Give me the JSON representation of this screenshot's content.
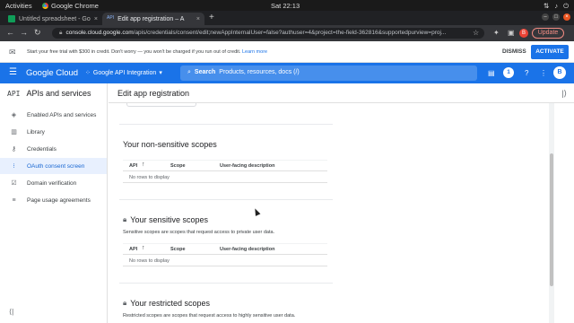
{
  "os": {
    "activities": "Activities",
    "app_name": "Google Chrome",
    "clock": "Sat 22:13"
  },
  "tabs": [
    {
      "title": "Untitled spreadsheet - Go",
      "close": "×"
    },
    {
      "title": "Edit app registration – A",
      "favicon": "API",
      "close": "×"
    }
  ],
  "browser": {
    "new_tab": "+",
    "url_host": "console.cloud.google.com",
    "url_path": "/apis/credentials/consent/edit;newAppInternalUser=false?authuser=4&project=the-field-362816&supportedpurview=proj...",
    "update_label": "Update",
    "profile_initial": "B"
  },
  "banner": {
    "message": "Start your free trial with $300 in credit. Don't worry — you won't be charged if you run out of credit.",
    "link": "Learn more",
    "dismiss": "DISMISS",
    "activate": "ACTIVATE"
  },
  "header": {
    "brand": "Google Cloud",
    "project": "Google API Integration",
    "search_label": "Search",
    "search_placeholder": "Products, resources, docs (/)",
    "notification_count": "1",
    "user_initial": "B"
  },
  "sidebar": {
    "title": "APIs and services",
    "api_glyph": "API",
    "items": [
      {
        "label": "Enabled APIs and services",
        "icon": "diamond-icon"
      },
      {
        "label": "Library",
        "icon": "library-icon"
      },
      {
        "label": "Credentials",
        "icon": "key-icon"
      },
      {
        "label": "OAuth consent screen",
        "icon": "consent-icon"
      },
      {
        "label": "Domain verification",
        "icon": "checkbox-icon"
      },
      {
        "label": "Page usage agreements",
        "icon": "settings-list-icon"
      }
    ]
  },
  "main": {
    "page_title": "Edit app registration",
    "sections": [
      {
        "title": "Your non-sensitive scopes",
        "description": "",
        "columns": [
          "API",
          "Scope",
          "User-facing description"
        ],
        "empty": "No rows to display"
      },
      {
        "title": "Your sensitive scopes",
        "description": "Sensitive scopes are scopes that request access to private user data.",
        "columns": [
          "API",
          "Scope",
          "User-facing description"
        ],
        "empty": "No rows to display"
      },
      {
        "title": "Your restricted scopes",
        "description": "Restricted scopes are scopes that request access to highly sensitive user data.",
        "columns": [],
        "empty": ""
      }
    ]
  },
  "colors": {
    "accent": "#1a73e8",
    "active_nav_bg": "#e8f0fe"
  }
}
